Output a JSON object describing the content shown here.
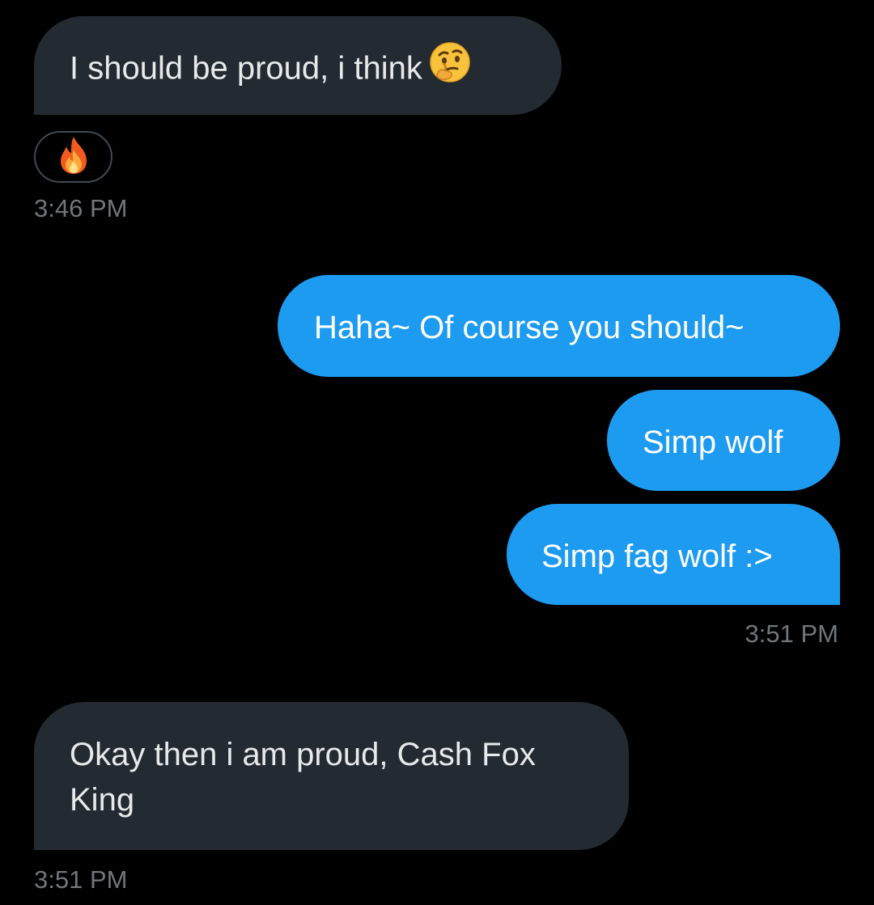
{
  "messages": [
    {
      "text": "I should be proud, i think",
      "emoji": "thinking-face",
      "direction": "incoming"
    },
    {
      "text": "Haha~ Of course you should~",
      "direction": "outgoing"
    },
    {
      "text": "Simp wolf",
      "direction": "outgoing"
    },
    {
      "text": "Simp fag wolf :>",
      "direction": "outgoing"
    },
    {
      "text": "Okay then i am proud, Cash Fox King",
      "direction": "incoming"
    }
  ],
  "reaction": {
    "emoji": "fire"
  },
  "timestamps": [
    "3:46 PM",
    "3:51 PM",
    "3:51 PM"
  ],
  "colors": {
    "background": "#000000",
    "incoming_bubble": "#232a31",
    "outgoing_bubble": "#1d9bf0",
    "text": "#e7e9ea",
    "timestamp": "#71767b"
  }
}
